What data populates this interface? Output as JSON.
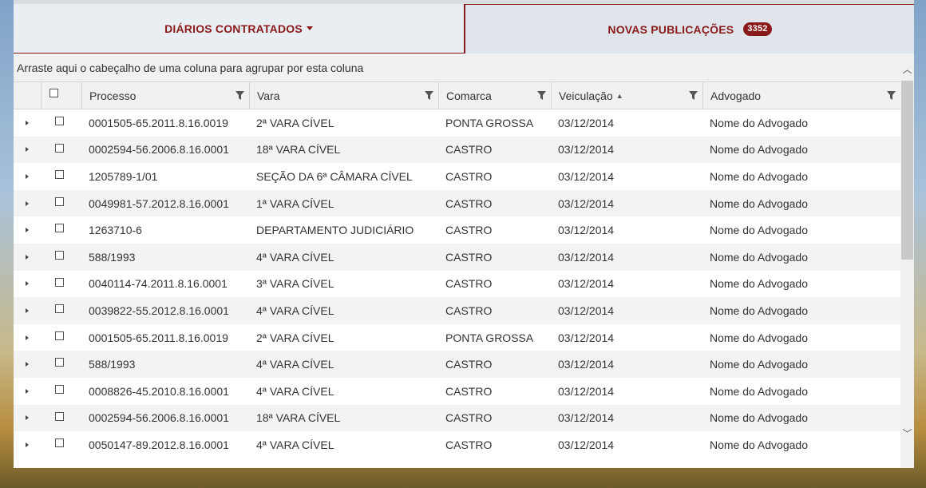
{
  "tabs": {
    "contracted": {
      "label": "DIÁRIOS CONTRATADOS"
    },
    "new_publications": {
      "label": "NOVAS PUBLICAÇÕES",
      "badge": "3352"
    }
  },
  "grid": {
    "group_hint": "Arraste aqui o cabeçalho de uma coluna para agrupar por esta coluna",
    "columns": {
      "processo": "Processo",
      "vara": "Vara",
      "comarca": "Comarca",
      "veiculacao": "Veiculação",
      "advogado": "Advogado"
    },
    "rows": [
      {
        "processo": "0001505-65.2011.8.16.0019",
        "vara": "2ª VARA CÍVEL",
        "comarca": "PONTA GROSSA",
        "veiculacao": "03/12/2014",
        "advogado": "Nome do Advogado"
      },
      {
        "processo": "0002594-56.2006.8.16.0001",
        "vara": "18ª VARA CÍVEL",
        "comarca": "CASTRO",
        "veiculacao": "03/12/2014",
        "advogado": "Nome do Advogado"
      },
      {
        "processo": "1205789-1/01",
        "vara": "SEÇÃO DA 6ª CÂMARA CÍVEL",
        "comarca": "CASTRO",
        "veiculacao": "03/12/2014",
        "advogado": "Nome do Advogado"
      },
      {
        "processo": "0049981-57.2012.8.16.0001",
        "vara": "1ª VARA CÍVEL",
        "comarca": "CASTRO",
        "veiculacao": "03/12/2014",
        "advogado": "Nome do Advogado"
      },
      {
        "processo": "1263710-6",
        "vara": "DEPARTAMENTO JUDICIÁRIO",
        "comarca": "CASTRO",
        "veiculacao": "03/12/2014",
        "advogado": "Nome do Advogado"
      },
      {
        "processo": "588/1993",
        "vara": "4ª VARA CÍVEL",
        "comarca": "CASTRO",
        "veiculacao": "03/12/2014",
        "advogado": "Nome do Advogado"
      },
      {
        "processo": "0040114-74.2011.8.16.0001",
        "vara": "3ª VARA CÍVEL",
        "comarca": "CASTRO",
        "veiculacao": "03/12/2014",
        "advogado": "Nome do Advogado"
      },
      {
        "processo": "0039822-55.2012.8.16.0001",
        "vara": "4ª VARA CÍVEL",
        "comarca": "CASTRO",
        "veiculacao": "03/12/2014",
        "advogado": "Nome do Advogado"
      },
      {
        "processo": "0001505-65.2011.8.16.0019",
        "vara": "2ª VARA CÍVEL",
        "comarca": "PONTA GROSSA",
        "veiculacao": "03/12/2014",
        "advogado": "Nome do Advogado"
      },
      {
        "processo": "588/1993",
        "vara": "4ª VARA CÍVEL",
        "comarca": "CASTRO",
        "veiculacao": "03/12/2014",
        "advogado": "Nome do Advogado"
      },
      {
        "processo": "0008826-45.2010.8.16.0001",
        "vara": "4ª VARA CÍVEL",
        "comarca": "CASTRO",
        "veiculacao": "03/12/2014",
        "advogado": "Nome do Advogado"
      },
      {
        "processo": "0002594-56.2006.8.16.0001",
        "vara": "18ª VARA CÍVEL",
        "comarca": "CASTRO",
        "veiculacao": "03/12/2014",
        "advogado": "Nome do Advogado"
      },
      {
        "processo": "0050147-89.2012.8.16.0001",
        "vara": "4ª VARA CÍVEL",
        "comarca": "CASTRO",
        "veiculacao": "03/12/2014",
        "advogado": "Nome do Advogado"
      }
    ]
  },
  "icons": {
    "filter": "filter-icon",
    "sort": "sort-ascending-icon",
    "expand": "expand-row-icon",
    "scroll_up": "chevron-up-icon",
    "scroll_down": "chevron-down-icon"
  },
  "colors": {
    "accent": "#8a1a1a"
  }
}
